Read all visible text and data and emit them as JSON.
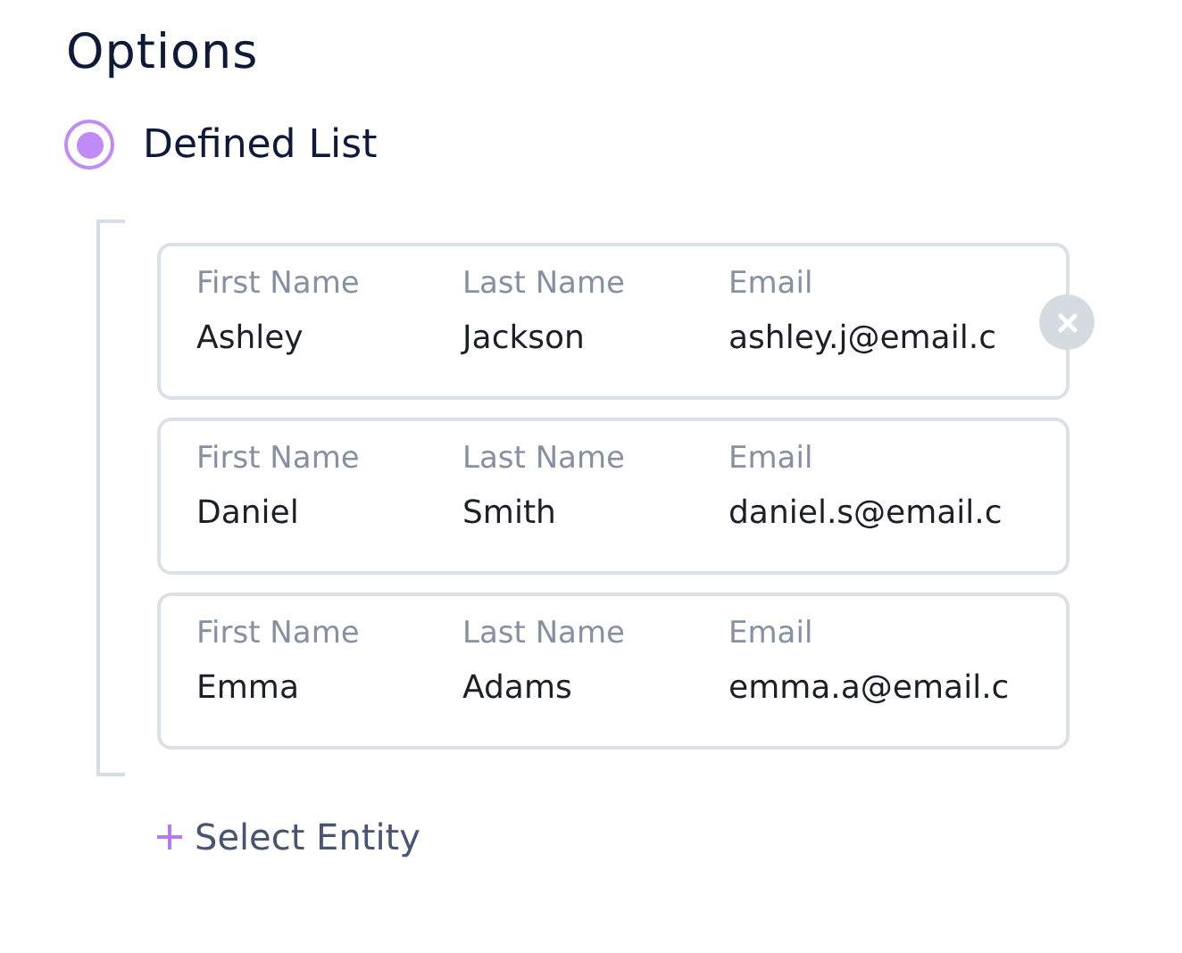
{
  "section_title": "Options",
  "option": {
    "label": "Defined List",
    "selected": true
  },
  "entities": [
    {
      "fields": [
        {
          "label": "First Name",
          "value": "Ashley"
        },
        {
          "label": "Last Name",
          "value": "Jackson"
        },
        {
          "label": "Email",
          "value": "ashley.j@email.c"
        }
      ],
      "show_remove": true
    },
    {
      "fields": [
        {
          "label": "First Name",
          "value": "Daniel"
        },
        {
          "label": "Last Name",
          "value": "Smith"
        },
        {
          "label": "Email",
          "value": "daniel.s@email.c"
        }
      ],
      "show_remove": false
    },
    {
      "fields": [
        {
          "label": "First Name",
          "value": "Emma"
        },
        {
          "label": "Last Name",
          "value": "Adams"
        },
        {
          "label": "Email",
          "value": "emma.a@email.c"
        }
      ],
      "show_remove": false
    }
  ],
  "add_button": {
    "label": "Select Entity"
  }
}
